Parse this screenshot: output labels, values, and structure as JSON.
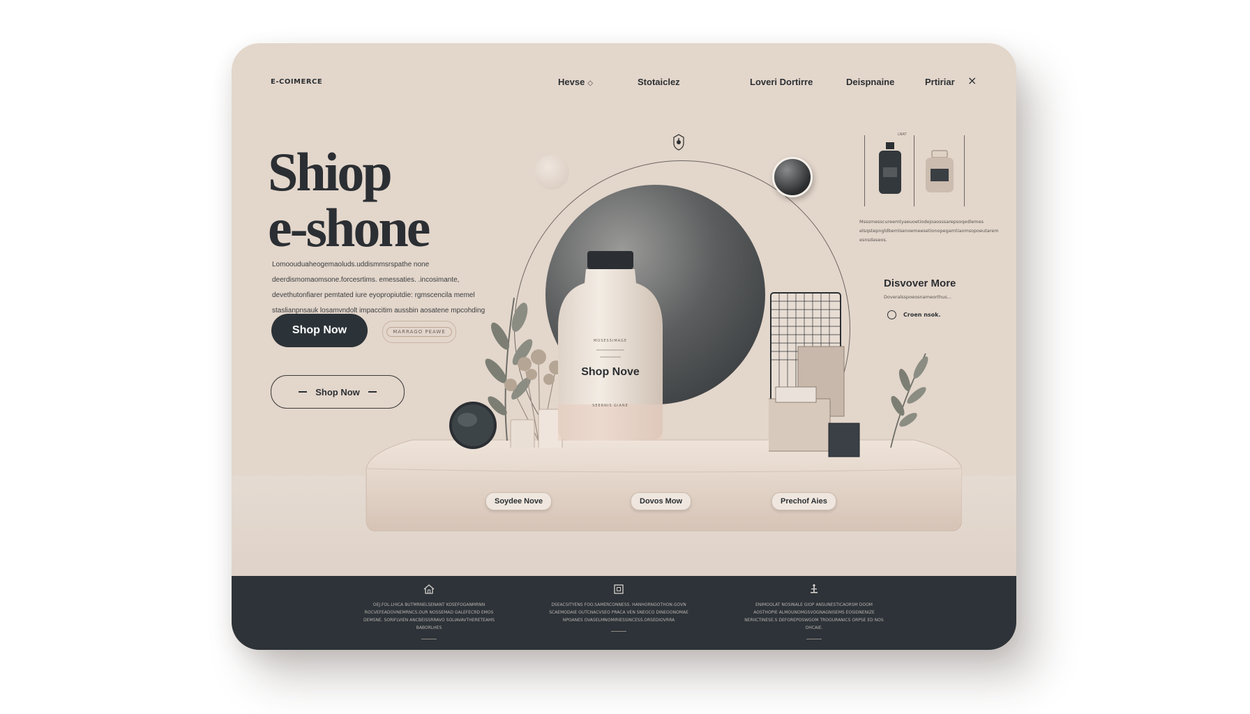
{
  "brand": "E-COIMERCE",
  "nav": {
    "items": [
      {
        "label": "Hevse",
        "chevron": "◇"
      },
      {
        "label": "Stotaiclez"
      },
      {
        "label": "Loveri Dortirre"
      },
      {
        "label": "Deispnaine"
      },
      {
        "label": "Prtiriar"
      }
    ],
    "close": "×"
  },
  "hero": {
    "title_line1": "Shiop",
    "title_line2": "e-shone",
    "text": "Lomoouduaheogemaoluds.uddismmsrspathe none deerdismomaomsone.forcesrtims. emessaties. .incosimante, devethutonfiarer pemtated iure eyopropiutdie: rgmscencila memel staslianpnsauk losamvndolt impaccitim aussbin aosatene mpcohding syok..",
    "primary_button": "Shop Now",
    "pill_button": "MARRAGO PEAWE",
    "outline_button": "Shop Now"
  },
  "product": {
    "bottle_label": "Shop Nove",
    "bottle_sub": "MOSESSIMAGE",
    "bottle_foot": "SEERNIS GIANE"
  },
  "platform_chips": [
    "Soydee Nove",
    "Dovos Mow",
    "Prechof Aies"
  ],
  "right_panel": {
    "frame_label": "LNAT",
    "text": "Msssmesscureemtyaeuoetiodejoaosssarepsoqedlemes elsqstepngldbemlsenoemeesetionopegamtiaomsopoeutarem esnsdaseos.",
    "discover_title": "Disvover More",
    "discover_sub": "Doveralsspoeosnameorthus...",
    "radio_label": "Croen nsok."
  },
  "footer": {
    "columns": [
      {
        "icon": "home-icon",
        "text": "OEJ.FOL.LHICA BUTMRNELSENANT KOSEFOGANMRNN ROCVEFEADOVNEMRNCS.OUR NOSSEMAD GALEFECRD EMOS DEMSNE. SORIFLVIEN ANCBEISSRRAVO SOLIAVAVTHERETEAMS BABORLHES"
      },
      {
        "icon": "square-icon",
        "text": "DSEACSITYENS FOO.SAMERCONNESS. HANHORNGOTHON.GOVN SCAEMODAIE OUTCNACVSEO PRACA VEN SNEOCO DINEOONOMAE NPOANES OVASELMNOMIRIESSINCESS.ORSEDIOVRRA"
      },
      {
        "icon": "tool-icon",
        "text": "ENIMOOLAT NOSINALE GIOP ANSUNESTICAORSM DOOM AOSTHOPIE ALMOUNOMGSVOGNAGNISEMS EOSIDNENIZE NERIICTINESE.S DEFOREPOSWGOM TROOURANICS ORPSE ED NOS OHCAIE."
      }
    ]
  },
  "colors": {
    "background": "#e3d6cb",
    "dark": "#2d3338",
    "accent_stone": "#cdbdb0"
  }
}
